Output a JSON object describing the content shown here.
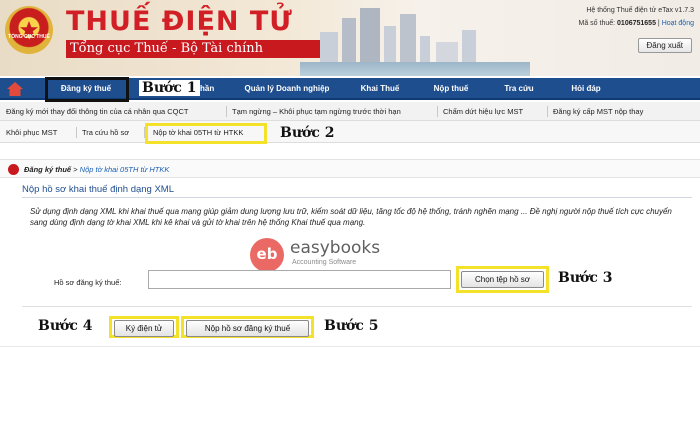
{
  "header": {
    "brand_title": "THUẾ ĐIỆN TỬ",
    "brand_subtitle": "Tổng cục Thuế - Bộ Tài chính",
    "emblem_text": "TỔNG CỤC THUẾ",
    "system_info": "Hệ thống Thuế điện tử eTax v1.7.3",
    "taxcode_label": "Mã số thuế:",
    "taxcode_value": "0106751655",
    "host_link": "Hoạt động",
    "logout_button": "Đăng xuất"
  },
  "main_nav": {
    "items": [
      {
        "label": "Đăng ký thuế"
      },
      {
        "label": "Quản lý Doanh nghiệp"
      },
      {
        "label": "Khai Thuế"
      },
      {
        "label": "Nộp thuế"
      },
      {
        "label": "Tra cứu"
      },
      {
        "label": "Hỏi đáp"
      }
    ],
    "hidden_fragment": "hần"
  },
  "sub_nav": {
    "row1": [
      {
        "label": "Đăng ký mới thay đổi thông tin của cá nhân qua CQCT"
      },
      {
        "label": "Tạm ngừng – Khôi phục tạm ngừng trước thời hạn"
      },
      {
        "label": "Chấm dứt hiệu lực MST"
      },
      {
        "label": "Đăng ký cấp MST nộp thay"
      }
    ],
    "row2": [
      {
        "label": "Khôi phục MST"
      },
      {
        "label": "Tra cứu hồ sơ"
      },
      {
        "label": "Nộp tờ khai 05TH từ HTKK"
      }
    ]
  },
  "annotations": {
    "step1": "Bước 1",
    "step2": "Bước 2",
    "step3": "Bước 3",
    "step4": "Bước 4",
    "step5": "Bước 5",
    "highlight_color": "#f4e22a"
  },
  "breadcrumb": {
    "parent": "Đăng ký thuế",
    "separator": " > ",
    "current": "Nộp tờ khai 05TH từ HTKK"
  },
  "page": {
    "title": "Nộp hồ sơ khai thuế định dạng XML",
    "description": "Sử dụng định dạng XML khi khai thuế qua mạng giúp giảm dung lượng lưu trữ, kiểm soát dữ liệu, tăng tốc độ hệ thống, tránh nghẽn mạng ... Đề nghị người nộp thuế tích cực chuyển sang dùng định dạng tờ khai XML khi kê khai và gửi tờ khai trên hệ thống Khai thuế qua mạng."
  },
  "form": {
    "file_label": "Hồ sơ đăng ký thuế:",
    "file_value": "",
    "choose_file_button": "Chọn tệp hồ sơ",
    "sign_button": "Ký điện tử",
    "submit_button": "Nộp hồ sơ đăng ký thuế"
  },
  "watermark": {
    "logo": "eb",
    "name": "easybooks",
    "tagline": "Accounting Software"
  },
  "colors": {
    "nav_bg": "#1f4e8f",
    "brand_red": "#d21f26",
    "link_blue": "#1a5fb4"
  }
}
